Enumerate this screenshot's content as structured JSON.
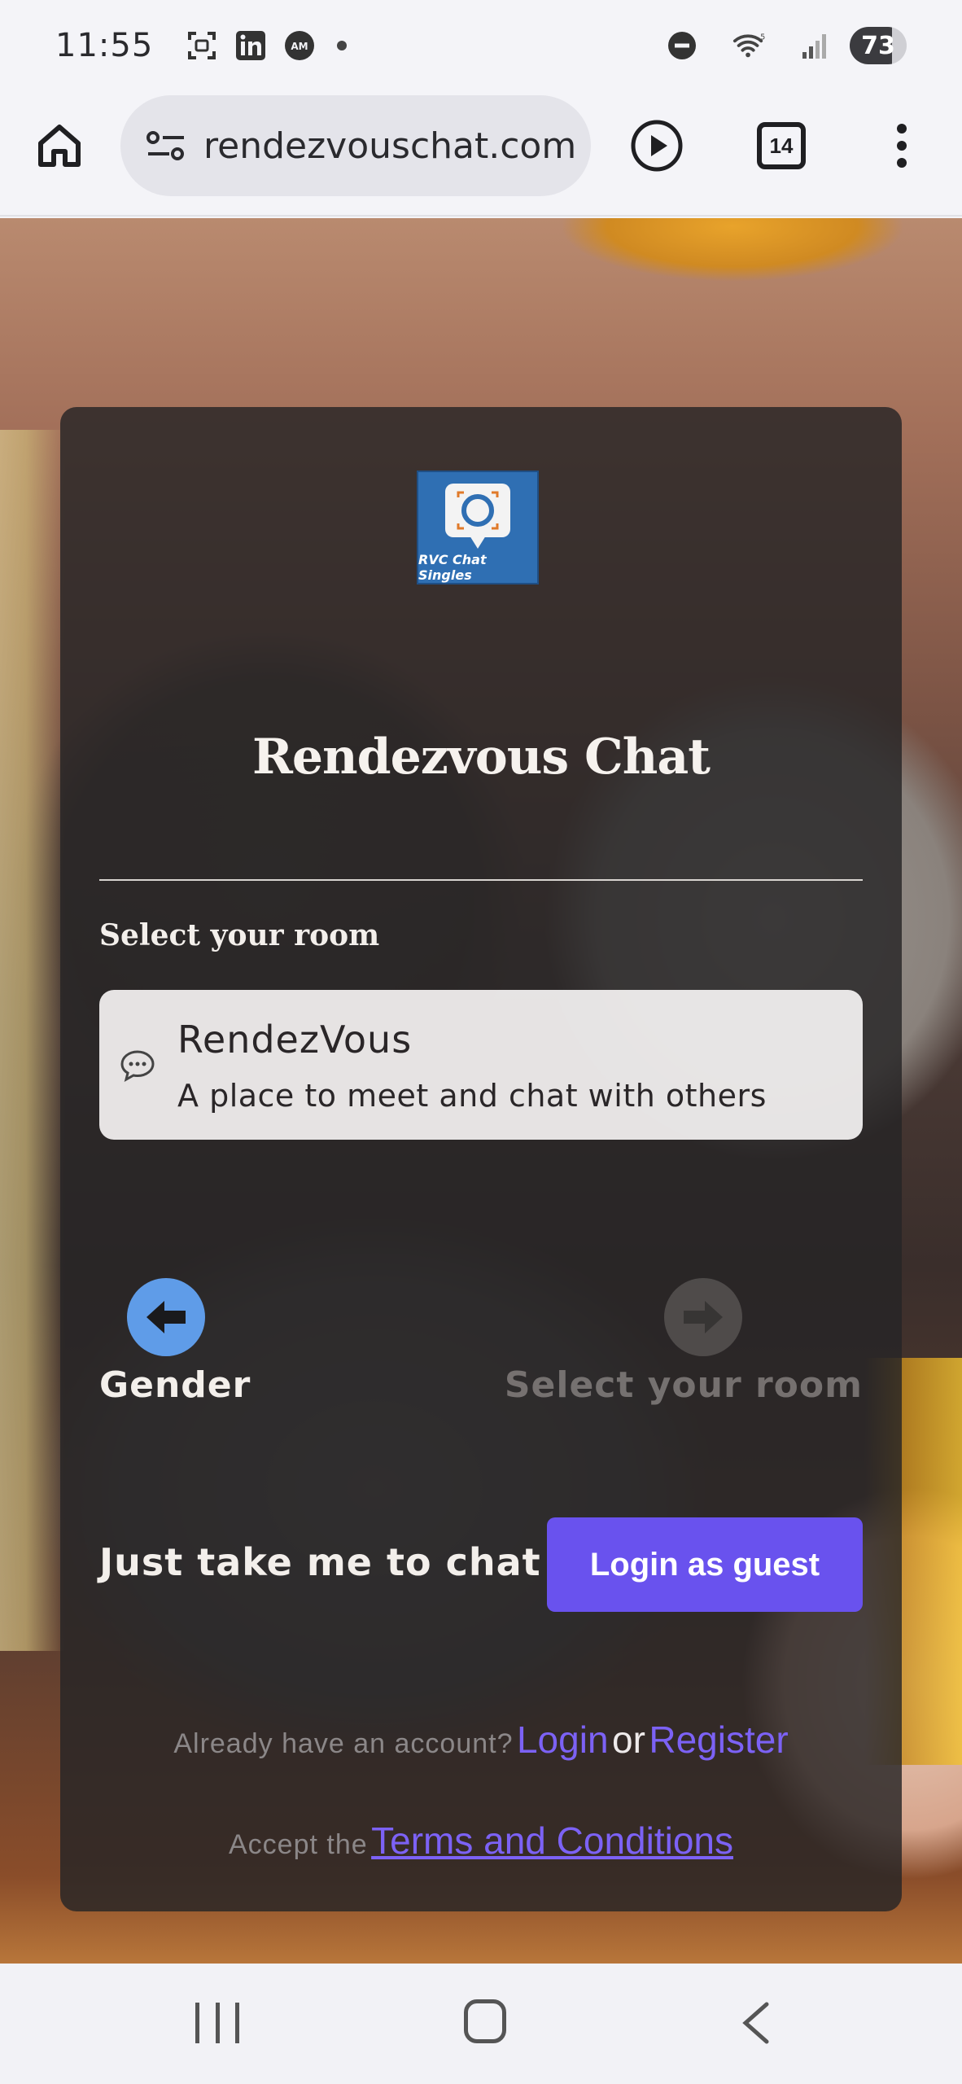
{
  "status_bar": {
    "time": "11:55",
    "icons": [
      "screenshot-icon",
      "linkedin-icon",
      "amex-icon",
      "notification-dot"
    ],
    "right_icons": [
      "do-not-disturb-icon",
      "wifi-icon",
      "signal-icon"
    ],
    "battery": "73"
  },
  "browser": {
    "url": "rendezvouschat.com",
    "tab_count": "14"
  },
  "card": {
    "logo_text": "RVC Chat Singles",
    "title": "Rendezvous Chat",
    "section_label": "Select your room",
    "room": {
      "name": "RendezVous",
      "description": "A place to meet and chat with others"
    },
    "steps": {
      "back_label": "Gender",
      "next_label": "Select your room"
    },
    "quick_chat_label": "Just take me to chat",
    "guest_button": "Login as guest",
    "account_prompt": "Already have an account?",
    "login_link": "Login",
    "or_text": "or",
    "register_link": "Register",
    "terms_prefix": "Accept the",
    "terms_link": "Terms and Conditions"
  },
  "colors": {
    "accent": "#6952ee",
    "link": "#7c62f5",
    "step_active": "#5f9ce8"
  }
}
